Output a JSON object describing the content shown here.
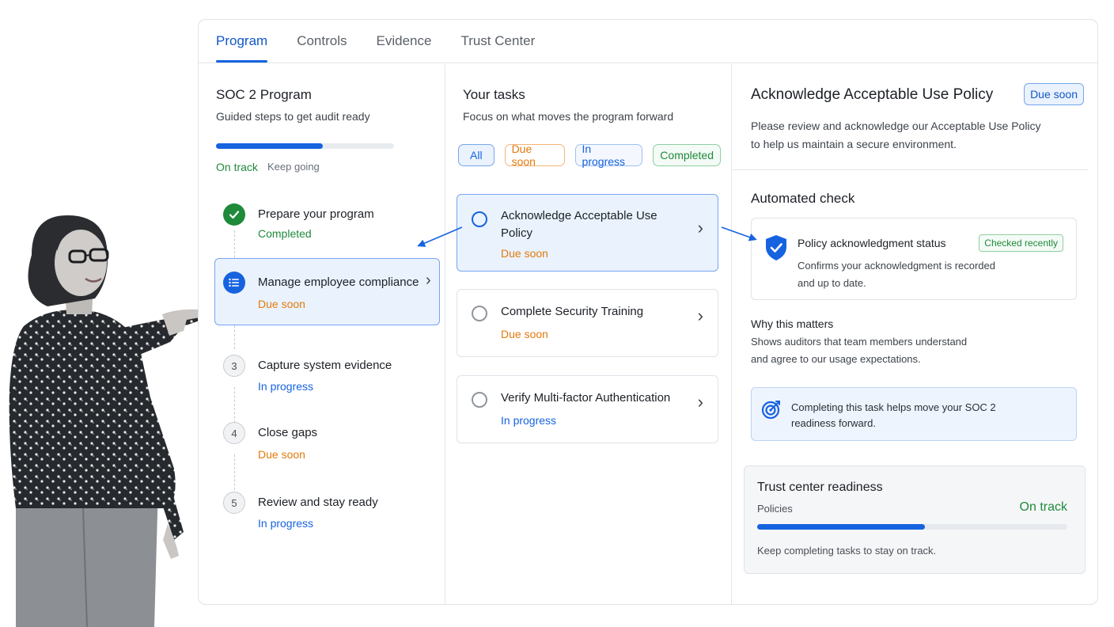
{
  "tabs": [
    {
      "label": "Program",
      "active": true
    },
    {
      "label": "Controls"
    },
    {
      "label": "Evidence"
    },
    {
      "label": "Trust Center"
    }
  ],
  "program": {
    "title": "SOC 2 Program",
    "subtitle": "Guided steps to get audit ready",
    "progress_fraction": 0.6,
    "status": "On track",
    "status_note": "Keep going",
    "steps": [
      {
        "title": "Prepare your program",
        "status": "Completed",
        "icon": "check-icon"
      },
      {
        "title": "Manage employee compliance",
        "status": "Due soon",
        "icon": "list-icon"
      },
      {
        "number": "3",
        "title": "Capture system evidence",
        "status": "In progress"
      },
      {
        "number": "4",
        "title": "Close gaps",
        "status": "Due soon"
      },
      {
        "number": "5",
        "title": "Review and stay ready",
        "status": "In progress"
      }
    ]
  },
  "tasks": {
    "title": "Your tasks",
    "subtitle": "Focus on what moves the program forward",
    "filters": [
      "All",
      "Due soon",
      "In progress",
      "Completed"
    ],
    "items": [
      {
        "title": "Acknowledge Acceptable Use Policy",
        "status": "Due soon",
        "selected": true
      },
      {
        "title": "Complete Security Training",
        "status": "Due soon"
      },
      {
        "title": "Verify Multi-factor Authentication",
        "status": "In progress"
      }
    ]
  },
  "detail": {
    "title": "Acknowledge Acceptable Use Policy",
    "badge": "Due soon",
    "description_line1": "Please review and acknowledge our Acceptable Use Policy",
    "description_line2": "to help us maintain a secure environment.",
    "automated_check_heading": "Automated check",
    "check": {
      "title": "Policy acknowledgment status",
      "badge": "Checked recently",
      "line1": "Confirms your acknowledgment is recorded",
      "line2": "and up to date.",
      "icon": "shield-check-icon"
    },
    "why_heading": "Why this matters",
    "why_line1": "Shows auditors that team members understand",
    "why_line2": "and agree to our usage expectations.",
    "info_line1": "Completing this task helps move your SOC 2",
    "info_line2": "readiness forward.",
    "info_icon": "target-icon",
    "trust": {
      "title": "Trust center readiness",
      "label": "Policies",
      "status": "On track",
      "progress_fraction": 0.54,
      "note": "Keep completing tasks to stay on track."
    }
  },
  "colors": {
    "accent": "#1663e0",
    "success": "#1f8a3a",
    "warning": "#e27a0c"
  }
}
